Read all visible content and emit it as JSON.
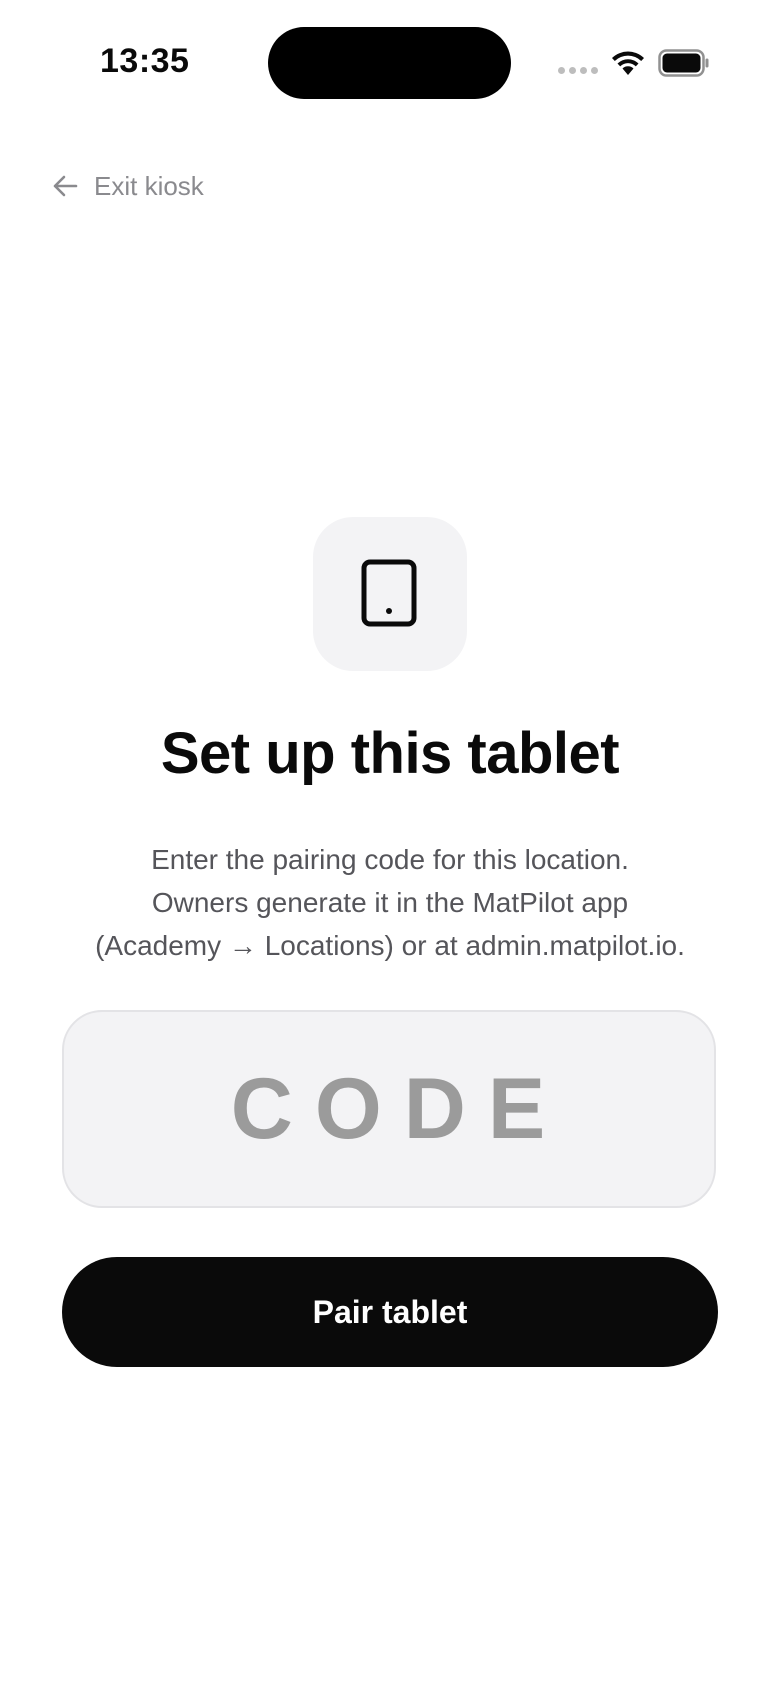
{
  "status_bar": {
    "time": "13:35",
    "icons": [
      "cellular-signal-icon",
      "wifi-icon",
      "battery-icon"
    ]
  },
  "nav": {
    "exit_label": "Exit kiosk",
    "exit_icon": "arrow-left-icon"
  },
  "hero": {
    "icon": "tablet-icon",
    "title": "Set up this tablet",
    "description_lines": [
      "Enter the pairing code for this location.",
      "Owners generate it in the MatPilot app",
      "(Academy → Locations) or at admin.matpilot.io."
    ]
  },
  "pairing": {
    "code_value": "",
    "code_placeholder": "CODE",
    "submit_label": "Pair tablet"
  },
  "colors": {
    "background": "#ffffff",
    "primary_button": "#0a0a0a",
    "primary_button_text": "#ffffff",
    "muted_text": "#8a8a8e",
    "input_background": "#f3f3f5",
    "placeholder": "#9b9b9b"
  }
}
